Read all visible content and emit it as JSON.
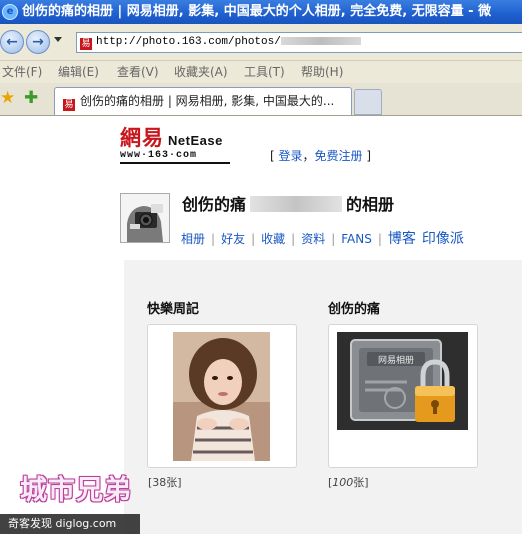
{
  "window": {
    "title": "创伤的痛的相册 | 网易相册, 影集, 中国最大的个人相册, 完全免费, 无限容量 - 微"
  },
  "toolbar": {
    "back_icon": "back-arrow-icon",
    "forward_icon": "forward-arrow-icon",
    "address_value": "http://photo.163.com/photos/"
  },
  "menu": {
    "items": [
      "文件(F)",
      "编辑(E)",
      "查看(V)",
      "收藏夹(A)",
      "工具(T)",
      "帮助(H)"
    ]
  },
  "tabs": {
    "active_label": "创伤的痛的相册 | 网易相册, 影集, 中国最大的..."
  },
  "header": {
    "logo_cn": "網易",
    "logo_en": "NetEase",
    "logo_url": "www·163·com",
    "login_open": "[ ",
    "login_label": "登录",
    "login_sep": "，",
    "register_label": "免费注册",
    "login_close": " ]"
  },
  "profile": {
    "name_prefix": "创伤的痛",
    "name_suffix": "的相册",
    "nav": [
      "相册",
      "好友",
      "收藏",
      "资料",
      "FANS",
      "博客",
      "印像派"
    ]
  },
  "albums": [
    {
      "title": "快樂周記",
      "count": "[38张]"
    },
    {
      "title": "创伤的痛",
      "count_open": "[",
      "count_num": "100",
      "count_close": "张]",
      "lock_text": "网易相册"
    }
  ],
  "overlay": {
    "watermark": "城市兄弟",
    "credit": "奇客发现 diglog.com"
  },
  "colors": {
    "brand_red": "#c9161d",
    "link_blue": "#1b58c4",
    "titlebar_blue": "#1e5fcf",
    "chrome": "#ece9d8"
  }
}
